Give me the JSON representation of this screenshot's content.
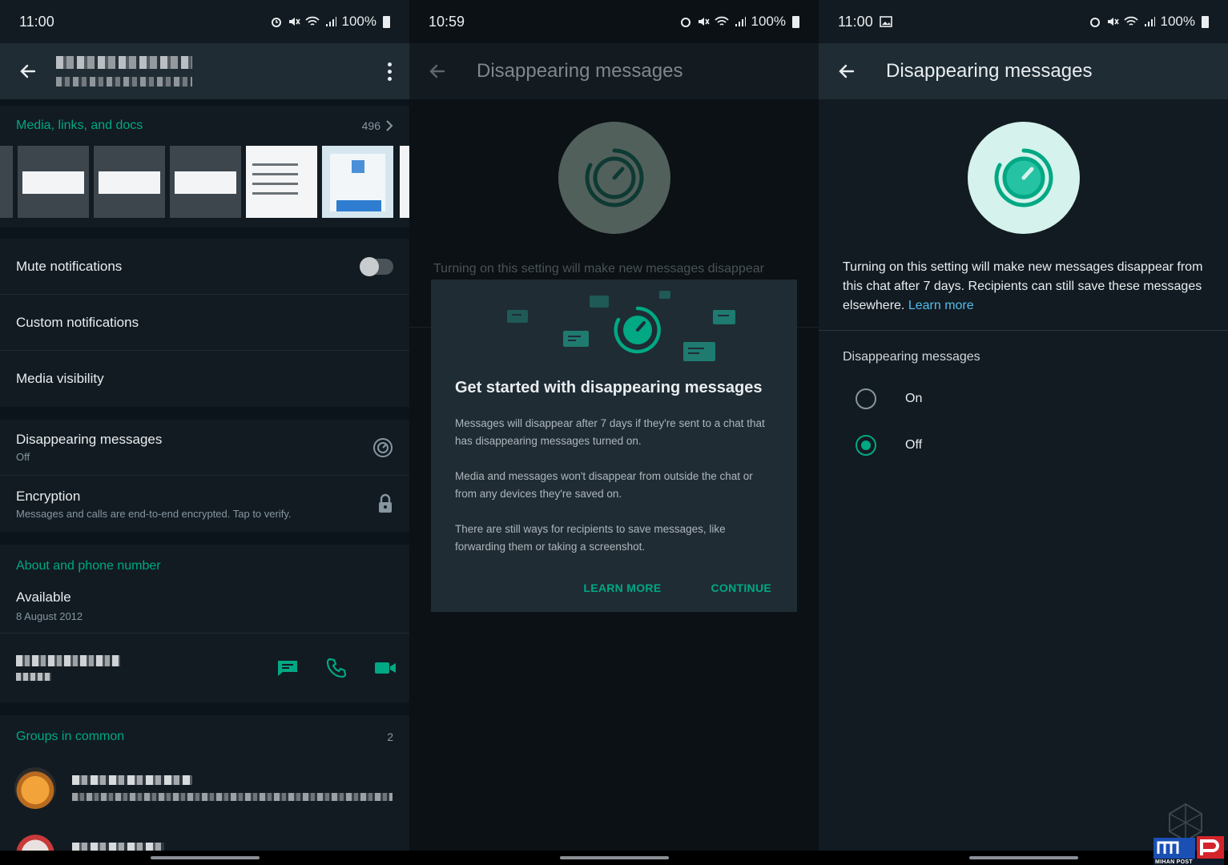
{
  "panel1": {
    "status_time": "11:00",
    "status_battery": "100%",
    "media": {
      "label": "Media, links, and docs",
      "count": "496"
    },
    "rows": [
      {
        "label": "Mute notifications"
      },
      {
        "label": "Custom notifications"
      },
      {
        "label": "Media visibility"
      }
    ],
    "disappearing": {
      "label": "Disappearing messages",
      "value": "Off"
    },
    "encryption": {
      "label": "Encryption",
      "sub": "Messages and calls are end-to-end encrypted. Tap to verify."
    },
    "about": {
      "label": "About and phone number",
      "status": "Available",
      "date": "8 August 2012"
    },
    "groups": {
      "label": "Groups in common",
      "count": "2"
    }
  },
  "panel2": {
    "status_time": "10:59",
    "status_battery": "100%",
    "title": "Disappearing messages",
    "intro": "Turning on this setting will make new messages disappear",
    "dialog": {
      "title": "Get started with disappearing messages",
      "p1": "Messages will disappear after 7 days if they're sent to a chat that has disappearing messages turned on.",
      "p2": "Media and messages won't disappear from outside the chat or from any devices they're saved on.",
      "p3": "There are still ways for recipients to save messages, like forwarding them or taking a screenshot.",
      "learn_more": "LEARN MORE",
      "continue": "CONTINUE"
    }
  },
  "panel3": {
    "status_time": "11:00",
    "status_battery": "100%",
    "title": "Disappearing messages",
    "desc": "Turning on this setting will make new messages disappear from this chat after 7 days. Recipients can still save these messages elsewhere.",
    "learn_more": "Learn more",
    "option_label": "Disappearing messages",
    "options": [
      {
        "label": "On",
        "selected": false
      },
      {
        "label": "Off",
        "selected": true
      }
    ]
  },
  "watermark": {
    "text": "MIHAN POST"
  },
  "colors": {
    "accent": "#00a884",
    "link": "#53bdeb",
    "background": "#121b22",
    "appbar": "#1f2c34"
  }
}
